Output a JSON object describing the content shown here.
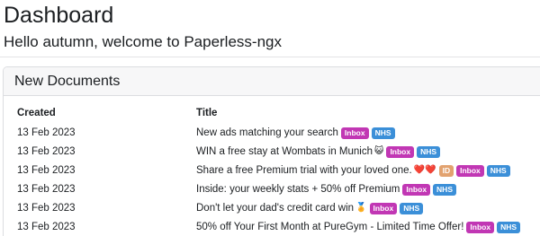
{
  "header": {
    "title": "Dashboard",
    "welcome": "Hello autumn, welcome to Paperless-ngx"
  },
  "widget": {
    "title": "New Documents",
    "columns": {
      "created": "Created",
      "title": "Title"
    },
    "rows": [
      {
        "created": "13 Feb 2023",
        "title": "New ads matching your search",
        "emoji": "",
        "tags": [
          {
            "label": "Inbox",
            "color": "#c137b4"
          },
          {
            "label": "NHS",
            "color": "#3b8fd8"
          }
        ]
      },
      {
        "created": "13 Feb 2023",
        "title": "WIN a free stay at Wombats in Munich",
        "emoji": "😺",
        "tags": [
          {
            "label": "Inbox",
            "color": "#c137b4"
          },
          {
            "label": "NHS",
            "color": "#3b8fd8"
          }
        ]
      },
      {
        "created": "13 Feb 2023",
        "title": "Share a free Premium trial with your loved one.",
        "emoji": "❤️❤️",
        "tags": [
          {
            "label": "ID",
            "color": "#e2a26f"
          },
          {
            "label": "Inbox",
            "color": "#c137b4"
          },
          {
            "label": "NHS",
            "color": "#3b8fd8"
          }
        ]
      },
      {
        "created": "13 Feb 2023",
        "title": "Inside: your weekly stats + 50% off Premium",
        "emoji": "",
        "tags": [
          {
            "label": "Inbox",
            "color": "#c137b4"
          },
          {
            "label": "NHS",
            "color": "#3b8fd8"
          }
        ]
      },
      {
        "created": "13 Feb 2023",
        "title": "Don't let your dad's credit card win",
        "emoji": "🏅",
        "tags": [
          {
            "label": "Inbox",
            "color": "#c137b4"
          },
          {
            "label": "NHS",
            "color": "#3b8fd8"
          }
        ]
      },
      {
        "created": "13 Feb 2023",
        "title": "50% off Your First Month at PureGym - Limited Time Offer!",
        "emoji": "",
        "tags": [
          {
            "label": "Inbox",
            "color": "#c137b4"
          },
          {
            "label": "NHS",
            "color": "#3b8fd8"
          }
        ]
      }
    ]
  }
}
